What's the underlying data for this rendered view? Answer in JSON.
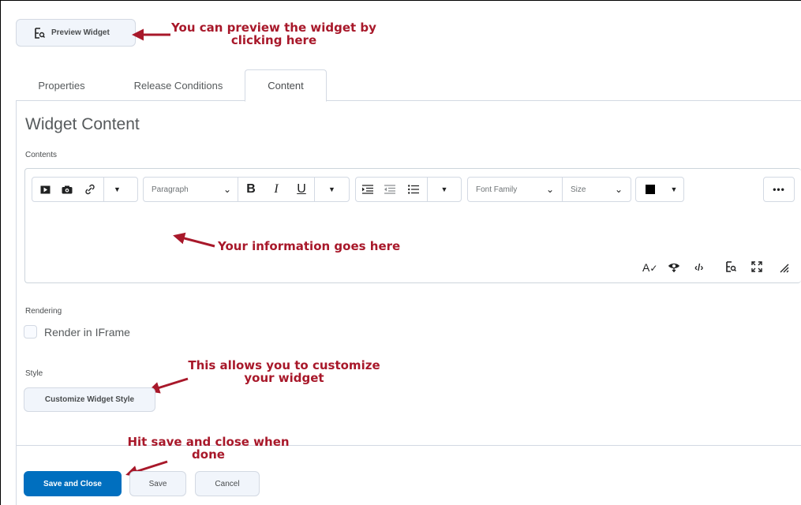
{
  "toolbar": {
    "preview_label": "Preview Widget"
  },
  "tabs": [
    {
      "label": "Properties"
    },
    {
      "label": "Release Conditions"
    },
    {
      "label": "Content"
    }
  ],
  "page_title": "Widget Content",
  "contents_label": "Contents",
  "editor": {
    "block_format": "Paragraph",
    "font_family": "Font Family",
    "font_size": "Size",
    "text_color": "#000000",
    "icons": [
      "insert-stuff-icon",
      "insert-image-icon",
      "insert-link-icon",
      "bold-icon",
      "italic-icon",
      "underline-icon",
      "indent-icon",
      "outdent-icon",
      "bullet-list-icon",
      "more-icon",
      "spellcheck-icon",
      "accessibility-icon",
      "source-code-icon",
      "preview-icon",
      "fullscreen-icon",
      "resize-icon"
    ]
  },
  "rendering": {
    "label": "Rendering",
    "checkbox_label": "Render in IFrame",
    "checked": false
  },
  "style": {
    "label": "Style",
    "button_label": "Customize Widget Style"
  },
  "footer": {
    "save_close": "Save and Close",
    "save": "Save",
    "cancel": "Cancel"
  },
  "annotations": {
    "preview": [
      "You can preview the widget by",
      "clicking here"
    ],
    "info": "Your information goes here",
    "style": [
      "This allows you to customize",
      "your widget"
    ],
    "save": [
      "Hit save and close when",
      "done"
    ]
  },
  "colors": {
    "accent": "#006fbf",
    "annotation": "#a8182a"
  }
}
